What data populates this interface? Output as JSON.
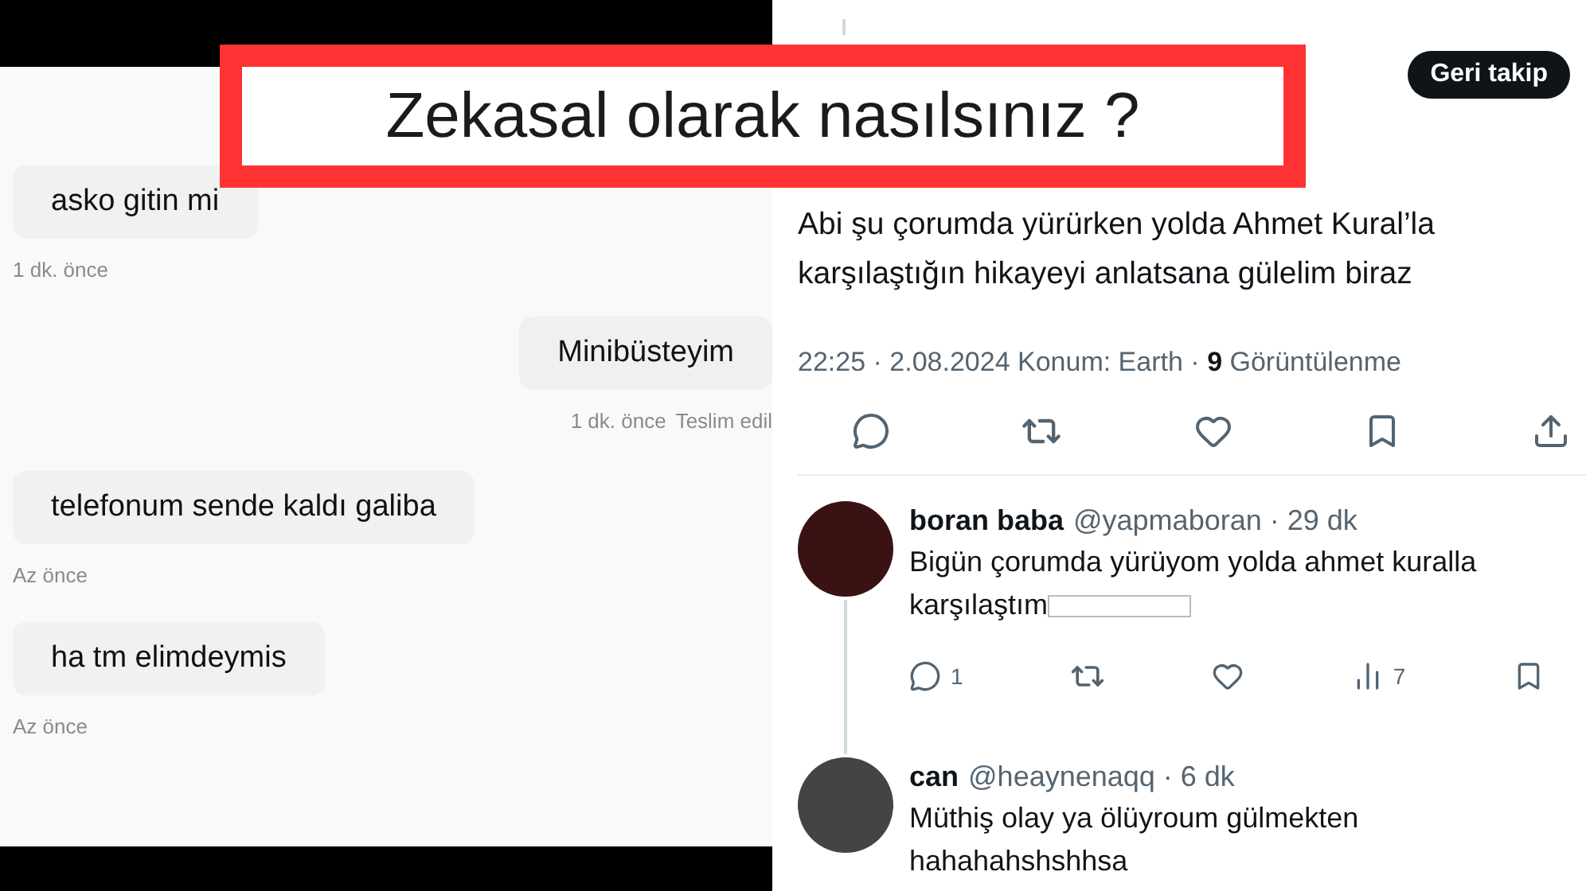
{
  "banner": {
    "title": "Zekasal olarak nasılsınız ?"
  },
  "chat": {
    "messages": [
      {
        "text": "asko gitin mi",
        "time": "1 dk. önce",
        "outgoing": false
      },
      {
        "text": "Minibüsteyim",
        "time": "1 dk. önce",
        "status": "Teslim edil",
        "outgoing": true
      },
      {
        "text": "telefonum sende kaldı galiba",
        "time": "Az önce",
        "outgoing": false
      },
      {
        "text": "ha tm elimdeymis",
        "time": "Az önce",
        "outgoing": false
      }
    ]
  },
  "tweet": {
    "follow_button": "Geri takip",
    "text": "Abi şu çorumda yürürken yolda Ahmet Kural’la karşılaştığın hikayeyi anlatsana gülelim biraz",
    "meta": "22:25 · 2.08.2024 Konum: Earth · **9** Görüntülenme"
  },
  "replies": [
    {
      "name": "boran baba",
      "handle": "@yapmaboran · 29 dk",
      "text": "Bigün çorumda yürüyom yolda ahmet kuralla karşılaştım",
      "redacted": true,
      "thread_line": true,
      "actions": {
        "reply_count": "1",
        "views": "7"
      }
    },
    {
      "name": "can",
      "handle": "@heaynenaqq · 6 dk",
      "text": "Müthiş olay ya ölüyroum gülmekten hahahahshshhsa",
      "redacted": false,
      "thread_line": false
    }
  ]
}
